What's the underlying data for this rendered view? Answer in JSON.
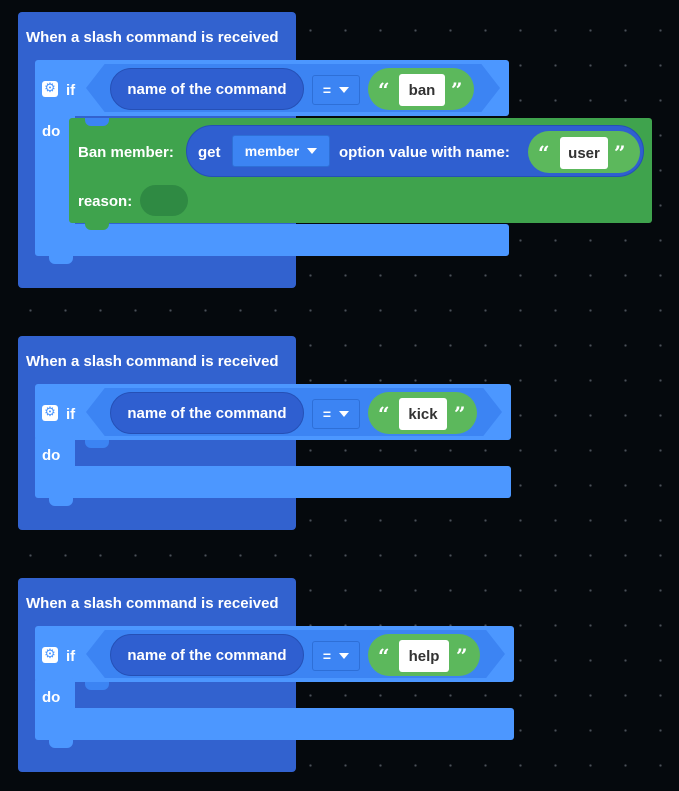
{
  "events": [
    {
      "title": "When a slash command is received",
      "if_label": "if",
      "do_label": "do",
      "condition": {
        "left": "name of the command",
        "operator": "=",
        "right": "ban"
      }
    },
    {
      "title": "When a slash command is received",
      "if_label": "if",
      "do_label": "do",
      "condition": {
        "left": "name of the command",
        "operator": "=",
        "right": "kick"
      }
    },
    {
      "title": "When a slash command is received",
      "if_label": "if",
      "do_label": "do",
      "condition": {
        "left": "name of the command",
        "operator": "=",
        "right": "help"
      }
    }
  ],
  "ban_block": {
    "label": "Ban member:",
    "get_label": "get",
    "dropdown_value": "member",
    "option_label": "option value with name:",
    "option_name": "user",
    "reason_label": "reason:"
  },
  "quotes": {
    "open": "“",
    "close": "”"
  },
  "icons": {
    "mutator": "gear-icon",
    "dropdown": "caret-down-icon"
  },
  "colors": {
    "event_block": "#3262cf",
    "if_block": "#4c97ff",
    "string_block": "#5cb85c",
    "ban_block": "#3fa34d",
    "workspace": "#05090d"
  }
}
